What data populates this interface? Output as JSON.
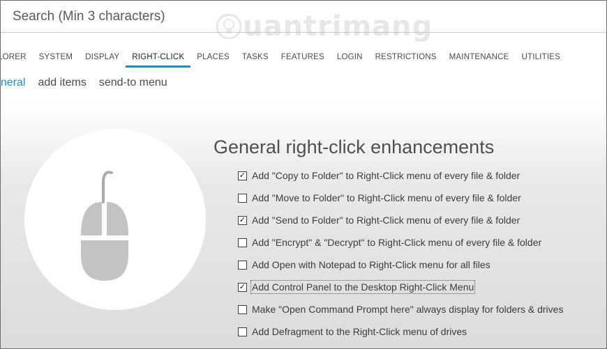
{
  "search": {
    "placeholder": "Search (Min 3 characters)",
    "value": ""
  },
  "watermark": {
    "text": "uantrimang"
  },
  "nav": {
    "tabs": [
      {
        "label": "LORER",
        "active": false
      },
      {
        "label": "SYSTEM",
        "active": false
      },
      {
        "label": "DISPLAY",
        "active": false
      },
      {
        "label": "RIGHT-CLICK",
        "active": true
      },
      {
        "label": "PLACES",
        "active": false
      },
      {
        "label": "TASKS",
        "active": false
      },
      {
        "label": "FEATURES",
        "active": false
      },
      {
        "label": "LOGIN",
        "active": false
      },
      {
        "label": "RESTRICTIONS",
        "active": false
      },
      {
        "label": "MAINTENANCE",
        "active": false
      },
      {
        "label": "UTILITIES",
        "active": false
      }
    ]
  },
  "subtabs": [
    {
      "label": "eneral",
      "active": true
    },
    {
      "label": "add items",
      "active": false
    },
    {
      "label": "send-to menu",
      "active": false
    }
  ],
  "section": {
    "title": "General right-click enhancements"
  },
  "options": [
    {
      "label": "Add \"Copy to Folder\" to Right-Click menu of every file & folder",
      "checked": true
    },
    {
      "label": "Add \"Move to Folder\" to Right-Click menu of every file & folder",
      "checked": false
    },
    {
      "label": "Add \"Send to Folder\" to Right-Click menu of every file & folder",
      "checked": true
    },
    {
      "label": "Add \"Encrypt\" & \"Decrypt\" to Right-Click menu of every file & folder",
      "checked": false
    },
    {
      "label": "Add Open with Notepad to Right-Click menu for all files",
      "checked": false
    },
    {
      "label": "Add Control Panel to the Desktop Right-Click Menu",
      "checked": true,
      "focused": true
    },
    {
      "label": "Make \"Open Command Prompt here\" always display for folders & drives",
      "checked": false
    },
    {
      "label": "Add Defragment to the Right-Click menu of drives",
      "checked": false
    }
  ],
  "icons": {
    "section_icon": "mouse-icon",
    "check_mark": "✓"
  },
  "colors": {
    "accent": "#1f8bc8"
  }
}
